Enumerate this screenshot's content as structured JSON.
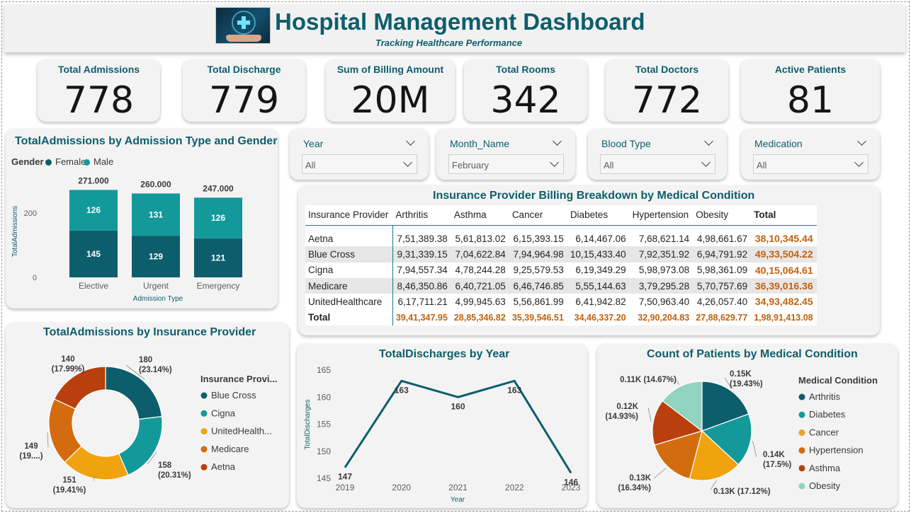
{
  "header": {
    "title": "Hospital Management Dashboard",
    "subtitle": "Tracking Healthcare Performance"
  },
  "kpis": [
    {
      "label": "Total Admissions",
      "value": "778"
    },
    {
      "label": "Total Discharge",
      "value": "779"
    },
    {
      "label": "Sum of Billing Amount",
      "value": "20M"
    },
    {
      "label": "Total Rooms",
      "value": "342"
    },
    {
      "label": "Total Doctors",
      "value": "772"
    },
    {
      "label": "Active Patients",
      "value": "81"
    }
  ],
  "slicers": [
    {
      "label": "Year",
      "value": "All"
    },
    {
      "label": "Month_Name",
      "value": "February"
    },
    {
      "label": "Blood Type",
      "value": "All"
    },
    {
      "label": "Medication",
      "value": "All"
    }
  ],
  "colors": {
    "teal_dark": "#0d5e6c",
    "teal": "#14999b",
    "orange": "#f0a20f",
    "brown_orange": "#d36c0e",
    "rust": "#b93f0d",
    "mint": "#8fd3c0",
    "total_text": "#c0620d"
  },
  "matrix": {
    "title": "Insurance Provider Billing Breakdown by Medical Condition",
    "columns": [
      "Insurance Provider",
      "Arthritis",
      "Asthma",
      "Cancer",
      "Diabetes",
      "Hypertension",
      "Obesity",
      "Total"
    ],
    "rows": [
      [
        "Aetna",
        "7,51,389.38",
        "5,61,813.02",
        "6,15,393.15",
        "6,14,467.06",
        "7,68,621.14",
        "4,98,661.67",
        "38,10,345.44"
      ],
      [
        "Blue Cross",
        "9,31,339.15",
        "7,04,622.84",
        "7,94,964.98",
        "10,15,433.40",
        "7,92,351.92",
        "6,94,791.92",
        "49,33,504.22"
      ],
      [
        "Cigna",
        "7,94,557.34",
        "4,78,244.28",
        "9,25,579.53",
        "6,19,349.29",
        "5,98,973.08",
        "5,98,361.09",
        "40,15,064.61"
      ],
      [
        "Medicare",
        "8,46,350.86",
        "6,40,721.05",
        "6,46,746.85",
        "5,55,144.63",
        "3,79,295.28",
        "5,70,757.69",
        "36,39,016.36"
      ],
      [
        "UnitedHealthcare",
        "6,17,711.21",
        "4,99,945.63",
        "5,56,861.99",
        "6,41,942.82",
        "7,50,963.40",
        "4,26,057.40",
        "34,93,482.45"
      ]
    ],
    "total_row": [
      "Total",
      "39,41,347.95",
      "28,85,346.82",
      "35,39,546.51",
      "34,46,337.20",
      "32,90,204.83",
      "27,88,629.77",
      "1,98,91,413.08"
    ]
  },
  "chart_data": [
    {
      "type": "bar",
      "stacked": true,
      "title": "TotalAdmissions by Admission Type and Gender",
      "xlabel": "Admission Type",
      "ylabel": "TotalAdmissions",
      "legend_title": "Gender",
      "legend_position": "top-left",
      "categories": [
        "Elective",
        "Urgent",
        "Emergency"
      ],
      "series": [
        {
          "name": "Female",
          "color": "#0d5e6c",
          "values": [
            145,
            129,
            121
          ]
        },
        {
          "name": "Male",
          "color": "#14999b",
          "values": [
            126,
            131,
            126
          ]
        }
      ],
      "totals": [
        "271.000",
        "260.000",
        "247.000"
      ],
      "yticks": [
        "0",
        "200"
      ],
      "ylim": [
        0,
        285
      ],
      "grid": false
    },
    {
      "type": "pie",
      "donut": true,
      "title": "TotalAdmissions by Insurance Provider",
      "legend_title": "Insurance Provi...",
      "legend_position": "right",
      "legend": [
        {
          "name": "Blue Cross",
          "color": "#0d5e6c"
        },
        {
          "name": "Cigna",
          "color": "#14999b"
        },
        {
          "name": "UnitedHealth...",
          "color": "#f0a20f"
        },
        {
          "name": "Medicare",
          "color": "#d36c0e"
        },
        {
          "name": "Aetna",
          "color": "#b93f0d"
        }
      ],
      "slices": [
        {
          "value": 180,
          "color": "#0d5e6c",
          "label": "180",
          "pct": "(23.14%)"
        },
        {
          "value": 158,
          "color": "#14999b",
          "label": "158",
          "pct": "(20.31%)"
        },
        {
          "value": 151,
          "color": "#f0a20f",
          "label": "151",
          "pct": "(19.41%)"
        },
        {
          "value": 149,
          "color": "#d36c0e",
          "label": "149",
          "pct": "(19....)"
        },
        {
          "value": 140,
          "color": "#b93f0d",
          "label": "140",
          "pct": "(17.99%)"
        }
      ]
    },
    {
      "type": "line",
      "title": "TotalDischarges by Year",
      "xlabel": "Year",
      "ylabel": "TotalDischarges",
      "x": [
        "2019",
        "2020",
        "2021",
        "2022",
        "2023"
      ],
      "series": [
        {
          "color": "#0d5e6c",
          "values": [
            147,
            163,
            160,
            163,
            146
          ]
        }
      ],
      "yticks": [
        "145",
        "150",
        "155",
        "160",
        "165"
      ],
      "ylim": [
        145,
        165
      ],
      "grid": false
    },
    {
      "type": "pie",
      "title": "Count of Patients by Medical Condition",
      "legend_title": "Medical Condition",
      "legend_position": "right",
      "legend": [
        {
          "name": "Arthritis",
          "color": "#0d5e6c"
        },
        {
          "name": "Diabetes",
          "color": "#14999b"
        },
        {
          "name": "Cancer",
          "color": "#f0a20f"
        },
        {
          "name": "Hypertension",
          "color": "#d36c0e"
        },
        {
          "name": "Asthma",
          "color": "#b93f0d"
        },
        {
          "name": "Obesity",
          "color": "#8fd3c0"
        }
      ],
      "slices": [
        {
          "value": 19.43,
          "color": "#0d5e6c",
          "label": "0.15K",
          "pct": "(19.43%)"
        },
        {
          "value": 17.5,
          "color": "#14999b",
          "label": "0.14K",
          "pct": "(17.5%)"
        },
        {
          "value": 17.12,
          "color": "#f0a20f",
          "label": "0.13K (17.12%)",
          "pct": ""
        },
        {
          "value": 16.34,
          "color": "#d36c0e",
          "label": "0.13K",
          "pct": "(16.34%)"
        },
        {
          "value": 14.93,
          "color": "#b93f0d",
          "label": "0.12K",
          "pct": "(14.93%)"
        },
        {
          "value": 14.67,
          "color": "#8fd3c0",
          "label": "0.11K (14.67%)",
          "pct": ""
        }
      ]
    }
  ]
}
